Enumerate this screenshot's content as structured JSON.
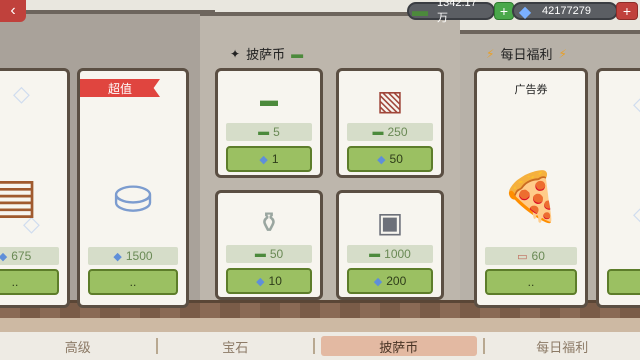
{
  "topbar": {
    "back_icon": "back-arrow-icon",
    "pizza_coins": "1342.17万",
    "gems": "42177279"
  },
  "sections": {
    "pizza_coin_title": "披萨币",
    "daily_welfare_title": "每日福利"
  },
  "cards_left": [
    {
      "price": "675",
      "button": ".."
    },
    {
      "badge": "超值",
      "price": "1500",
      "button": ".."
    }
  ],
  "pizza_shop": [
    {
      "amount": "5",
      "cost": "1"
    },
    {
      "amount": "250",
      "cost": "50"
    },
    {
      "amount": "50",
      "cost": "10"
    },
    {
      "amount": "1000",
      "cost": "200"
    }
  ],
  "daily": {
    "ad_title": "广告券",
    "price": "60",
    "button": ".."
  },
  "tabs": [
    "高级",
    "宝石",
    "披萨币",
    "每日福利"
  ],
  "active_tab": "披萨币",
  "colors": {
    "accent_red": "#e0453f",
    "button_green": "#9bc062",
    "gem_blue": "#5f8fd9"
  }
}
